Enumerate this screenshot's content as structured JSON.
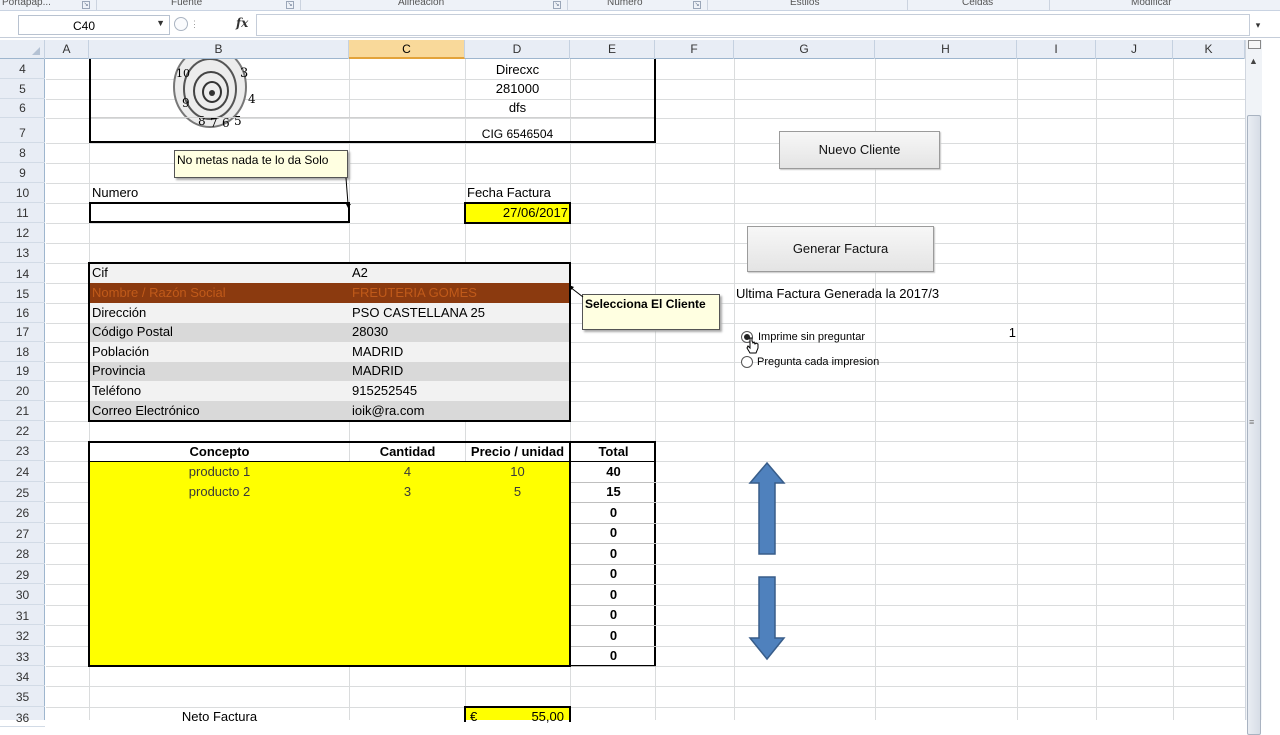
{
  "ribbon": {
    "groups": [
      "Portapap...",
      "Fuente",
      "Alineación",
      "Número",
      "Estilos",
      "Celdas",
      "Modificar"
    ]
  },
  "formula_bar": {
    "name_box": "C40",
    "fx_label": "fx",
    "content": ""
  },
  "columns": [
    "A",
    "B",
    "C",
    "D",
    "E",
    "F",
    "G",
    "H",
    "I",
    "J",
    "K"
  ],
  "selected_column": "C",
  "rows": [
    "4",
    "5",
    "6",
    "7",
    "8",
    "9",
    "10",
    "11",
    "12",
    "13",
    "14",
    "15",
    "16",
    "17",
    "18",
    "19",
    "20",
    "21",
    "22",
    "23",
    "24",
    "25",
    "26",
    "27",
    "28",
    "29",
    "30",
    "31",
    "32",
    "33",
    "34",
    "35",
    "36"
  ],
  "company": {
    "line1": "Direcxc",
    "line2": "281000",
    "line3": "dfs",
    "cig": "CIG 6546504"
  },
  "labels": {
    "numero": "Numero",
    "fecha_factura": "Fecha Factura",
    "fecha_value": "27/06/2017",
    "ultima_factura": "Ultima Factura Generada la 2017/3",
    "flag_value": "1"
  },
  "buttons": {
    "nuevo_cliente": "Nuevo Cliente",
    "generar_factura": "Generar Factura"
  },
  "notes": {
    "numero_note": "No metas nada te lo da Solo",
    "cliente_note": "Selecciona El Cliente"
  },
  "options": {
    "imprime": "Imprime  sin preguntar",
    "pregunta": "Pregunta cada impresion",
    "selected": "imprime"
  },
  "client": [
    {
      "label": "Cif",
      "value": "A2"
    },
    {
      "label": "Nombre / Razón Social",
      "value": "FREUTERIA GOMES"
    },
    {
      "label": "Dirección",
      "value": "PSO CASTELLANA 25"
    },
    {
      "label": "Código Postal",
      "value": "28030"
    },
    {
      "label": "Población",
      "value": "MADRID"
    },
    {
      "label": "Provincia",
      "value": "MADRID"
    },
    {
      "label": "Teléfono",
      "value": "915252545"
    },
    {
      "label": "Correo Electrónico",
      "value": "ioik@ra.com"
    }
  ],
  "items_table": {
    "headers": [
      "Concepto",
      "Cantidad",
      "Precio / unidad",
      "Total"
    ],
    "rows": [
      {
        "concepto": "producto 1",
        "cantidad": "4",
        "precio": "10",
        "total": "40"
      },
      {
        "concepto": "producto 2",
        "cantidad": "3",
        "precio": "5",
        "total": "15"
      },
      {
        "concepto": "",
        "cantidad": "",
        "precio": "",
        "total": "0"
      },
      {
        "concepto": "",
        "cantidad": "",
        "precio": "",
        "total": "0"
      },
      {
        "concepto": "",
        "cantidad": "",
        "precio": "",
        "total": "0"
      },
      {
        "concepto": "",
        "cantidad": "",
        "precio": "",
        "total": "0"
      },
      {
        "concepto": "",
        "cantidad": "",
        "precio": "",
        "total": "0"
      },
      {
        "concepto": "",
        "cantidad": "",
        "precio": "",
        "total": "0"
      },
      {
        "concepto": "",
        "cantidad": "",
        "precio": "",
        "total": "0"
      },
      {
        "concepto": "",
        "cantidad": "",
        "precio": "",
        "total": "0"
      }
    ]
  },
  "neto": {
    "label": "Neto Factura",
    "currency": "€",
    "value": "55,00"
  },
  "colors": {
    "yellow": "#ffff00",
    "brown": "#8b3a0f",
    "grey_row": "#d9d9d9",
    "light_row": "#f2f2f2",
    "arrow": "#4f81bd"
  },
  "icons": [
    "dropdown-arrow-icon",
    "fx-icon",
    "spiral-clock-image",
    "up-arrow-shape",
    "down-arrow-shape",
    "mouse-cursor-icon"
  ]
}
